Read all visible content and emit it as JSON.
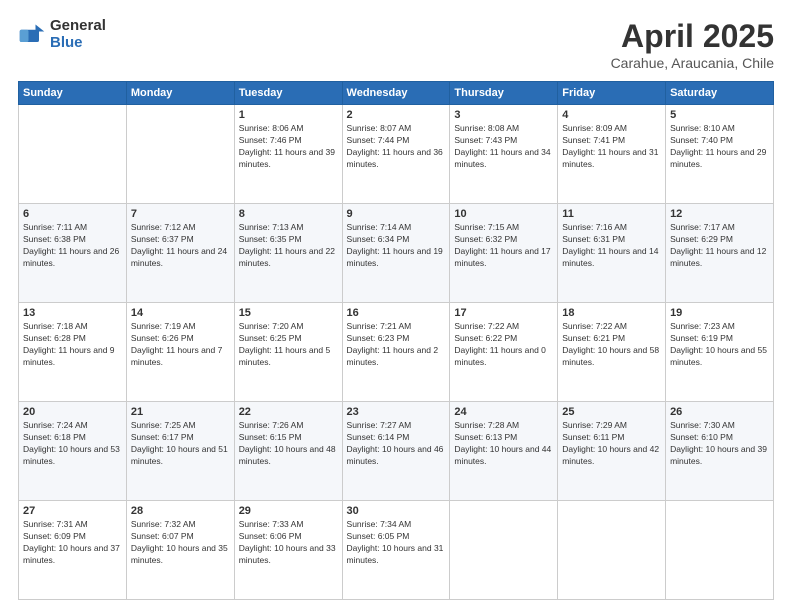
{
  "logo": {
    "general": "General",
    "blue": "Blue"
  },
  "header": {
    "title": "April 2025",
    "subtitle": "Carahue, Araucania, Chile"
  },
  "weekdays": [
    "Sunday",
    "Monday",
    "Tuesday",
    "Wednesday",
    "Thursday",
    "Friday",
    "Saturday"
  ],
  "weeks": [
    [
      {
        "day": "",
        "info": ""
      },
      {
        "day": "",
        "info": ""
      },
      {
        "day": "1",
        "info": "Sunrise: 8:06 AM\nSunset: 7:46 PM\nDaylight: 11 hours and 39 minutes."
      },
      {
        "day": "2",
        "info": "Sunrise: 8:07 AM\nSunset: 7:44 PM\nDaylight: 11 hours and 36 minutes."
      },
      {
        "day": "3",
        "info": "Sunrise: 8:08 AM\nSunset: 7:43 PM\nDaylight: 11 hours and 34 minutes."
      },
      {
        "day": "4",
        "info": "Sunrise: 8:09 AM\nSunset: 7:41 PM\nDaylight: 11 hours and 31 minutes."
      },
      {
        "day": "5",
        "info": "Sunrise: 8:10 AM\nSunset: 7:40 PM\nDaylight: 11 hours and 29 minutes."
      }
    ],
    [
      {
        "day": "6",
        "info": "Sunrise: 7:11 AM\nSunset: 6:38 PM\nDaylight: 11 hours and 26 minutes."
      },
      {
        "day": "7",
        "info": "Sunrise: 7:12 AM\nSunset: 6:37 PM\nDaylight: 11 hours and 24 minutes."
      },
      {
        "day": "8",
        "info": "Sunrise: 7:13 AM\nSunset: 6:35 PM\nDaylight: 11 hours and 22 minutes."
      },
      {
        "day": "9",
        "info": "Sunrise: 7:14 AM\nSunset: 6:34 PM\nDaylight: 11 hours and 19 minutes."
      },
      {
        "day": "10",
        "info": "Sunrise: 7:15 AM\nSunset: 6:32 PM\nDaylight: 11 hours and 17 minutes."
      },
      {
        "day": "11",
        "info": "Sunrise: 7:16 AM\nSunset: 6:31 PM\nDaylight: 11 hours and 14 minutes."
      },
      {
        "day": "12",
        "info": "Sunrise: 7:17 AM\nSunset: 6:29 PM\nDaylight: 11 hours and 12 minutes."
      }
    ],
    [
      {
        "day": "13",
        "info": "Sunrise: 7:18 AM\nSunset: 6:28 PM\nDaylight: 11 hours and 9 minutes."
      },
      {
        "day": "14",
        "info": "Sunrise: 7:19 AM\nSunset: 6:26 PM\nDaylight: 11 hours and 7 minutes."
      },
      {
        "day": "15",
        "info": "Sunrise: 7:20 AM\nSunset: 6:25 PM\nDaylight: 11 hours and 5 minutes."
      },
      {
        "day": "16",
        "info": "Sunrise: 7:21 AM\nSunset: 6:23 PM\nDaylight: 11 hours and 2 minutes."
      },
      {
        "day": "17",
        "info": "Sunrise: 7:22 AM\nSunset: 6:22 PM\nDaylight: 11 hours and 0 minutes."
      },
      {
        "day": "18",
        "info": "Sunrise: 7:22 AM\nSunset: 6:21 PM\nDaylight: 10 hours and 58 minutes."
      },
      {
        "day": "19",
        "info": "Sunrise: 7:23 AM\nSunset: 6:19 PM\nDaylight: 10 hours and 55 minutes."
      }
    ],
    [
      {
        "day": "20",
        "info": "Sunrise: 7:24 AM\nSunset: 6:18 PM\nDaylight: 10 hours and 53 minutes."
      },
      {
        "day": "21",
        "info": "Sunrise: 7:25 AM\nSunset: 6:17 PM\nDaylight: 10 hours and 51 minutes."
      },
      {
        "day": "22",
        "info": "Sunrise: 7:26 AM\nSunset: 6:15 PM\nDaylight: 10 hours and 48 minutes."
      },
      {
        "day": "23",
        "info": "Sunrise: 7:27 AM\nSunset: 6:14 PM\nDaylight: 10 hours and 46 minutes."
      },
      {
        "day": "24",
        "info": "Sunrise: 7:28 AM\nSunset: 6:13 PM\nDaylight: 10 hours and 44 minutes."
      },
      {
        "day": "25",
        "info": "Sunrise: 7:29 AM\nSunset: 6:11 PM\nDaylight: 10 hours and 42 minutes."
      },
      {
        "day": "26",
        "info": "Sunrise: 7:30 AM\nSunset: 6:10 PM\nDaylight: 10 hours and 39 minutes."
      }
    ],
    [
      {
        "day": "27",
        "info": "Sunrise: 7:31 AM\nSunset: 6:09 PM\nDaylight: 10 hours and 37 minutes."
      },
      {
        "day": "28",
        "info": "Sunrise: 7:32 AM\nSunset: 6:07 PM\nDaylight: 10 hours and 35 minutes."
      },
      {
        "day": "29",
        "info": "Sunrise: 7:33 AM\nSunset: 6:06 PM\nDaylight: 10 hours and 33 minutes."
      },
      {
        "day": "30",
        "info": "Sunrise: 7:34 AM\nSunset: 6:05 PM\nDaylight: 10 hours and 31 minutes."
      },
      {
        "day": "",
        "info": ""
      },
      {
        "day": "",
        "info": ""
      },
      {
        "day": "",
        "info": ""
      }
    ]
  ]
}
